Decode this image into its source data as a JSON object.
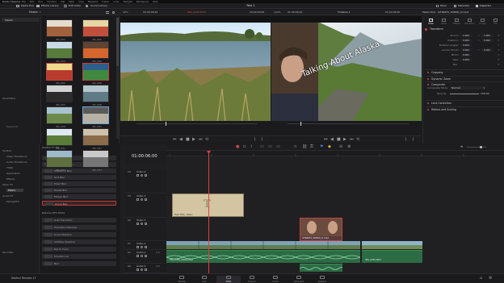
{
  "menu": {
    "app": "DaVinci Resolve",
    "items": [
      "File",
      "Edit",
      "Trim",
      "Timeline",
      "Clip",
      "Mark",
      "View",
      "Playback",
      "Fusion",
      "Color",
      "Fairlight",
      "Workspace",
      "Help"
    ]
  },
  "project_title": "Test 1",
  "toolbar": {
    "media_pool": "Media Pool",
    "effects_library": "Effects Library",
    "edit_index": "Edit Index",
    "sound_library": "Sound Library",
    "mixer": "Mixer",
    "metadata": "Metadata",
    "inspector": "Inspector"
  },
  "media_pool": {
    "bin_label": "Master",
    "smart_bins": "Smart Bins",
    "keywords": "Keywords",
    "sidebar_master": "Master"
  },
  "source_viewer": {
    "zoom": "42%",
    "clip_name": "IMG_0305.MOV",
    "timecode_left": "00:00:08:26",
    "timecode_right": "00:00:00:00"
  },
  "timeline_viewer": {
    "zoom": "100%",
    "timeline_name": "Timeline 1",
    "timecode": "01:00:06:00",
    "overlay_text": "Talking About Alaska"
  },
  "inspector": {
    "file_label": "Media Pool - IAT8ZKT2_5DMKD_D.mp4",
    "tabs": [
      "Video",
      "Audio",
      "Effects",
      "Transition",
      "Image",
      "File"
    ],
    "transform_title": "Transform",
    "rows": [
      {
        "label": "Zoom",
        "x": "1.000",
        "y": "1.000"
      },
      {
        "label": "Position",
        "x": "0.000",
        "y": "0.000"
      },
      {
        "label": "Rotation Angle",
        "x": "0.000",
        "y": ""
      },
      {
        "label": "Anchor Point",
        "x": "0.000",
        "y": "0.000"
      },
      {
        "label": "Pitch",
        "x": "0.000",
        "y": ""
      },
      {
        "label": "Yaw",
        "x": "0.000",
        "y": ""
      },
      {
        "label": "Flip",
        "x": "",
        "y": ""
      }
    ],
    "sections": [
      "Cropping",
      "Dynamic Zoom",
      "Composite",
      "Lens Correction",
      "Retime and Scaling"
    ],
    "composite_mode_label": "Composite Mode",
    "composite_mode_value": "Normal",
    "opacity_label": "Opacity",
    "opacity_value": "100.00"
  },
  "effects_panel": {
    "tree": [
      "Toolbox",
      "Video Transitions",
      "Audio Transitions",
      "Titles",
      "Generators",
      "Effects",
      "Open FX",
      "Filters",
      "Audio FX",
      "FairlightFX"
    ],
    "toolbox_header": "Toolbox Fx Bar",
    "toolbox_items": [
      "Lens Blur",
      "Adjustment Clip",
      "Transform Blur",
      "Grid Blur",
      "Prism Blur",
      "Radial Blur",
      "Mosaic Blur",
      "Zoom Blur"
    ],
    "transitions_header": "Resolve OFX Shots",
    "transition_items": [
      "Auto Transition",
      "Transition Dissolve",
      "Cross Dissolve",
      "Additive Dissolve",
      "Dip to Color",
      "Smooth Cut",
      "Blur"
    ],
    "favorites": "Favorites"
  },
  "timeline": {
    "timecode": "01:00:06:00",
    "tracks": [
      {
        "id": "V4",
        "name": "Video 4",
        "clips": ""
      },
      {
        "id": "V3",
        "name": "Video 3",
        "clips": ""
      },
      {
        "id": "V2",
        "name": "Video 2",
        "clips": ""
      },
      {
        "id": "V1",
        "name": "Video 1",
        "clips": ""
      },
      {
        "id": "A1",
        "name": "Audio 1",
        "clips": "2.0"
      },
      {
        "id": "A2",
        "name": "Audio 2",
        "clips": "2.0"
      }
    ],
    "clips": {
      "title_clip": "Text Title - Basic",
      "v2_clip": "IAT8ZKT2_5DMKD_D.mp4",
      "v1_clip": "IMG_0305.MOV",
      "a1_clip": "IMG_0305_Master.mp3",
      "a2_clip": "IMG_0305.MOV"
    }
  },
  "pages": [
    "Media",
    "Cut",
    "Edit",
    "Fusion",
    "Color",
    "Fairlight",
    "Deliver"
  ],
  "brand": "DaVinci Resolve 17",
  "thumbs": [
    "IMG_0301",
    "IMG_0302",
    "IMG_0303",
    "IMG_0304",
    "IMG_0305",
    "IMG_0306",
    "IMG_0307",
    "IMG_0308",
    "IMG_0309",
    "IMG_0310",
    "IMG_0311",
    "IMG_0312",
    "IMG_0313",
    "IMG_0314"
  ]
}
